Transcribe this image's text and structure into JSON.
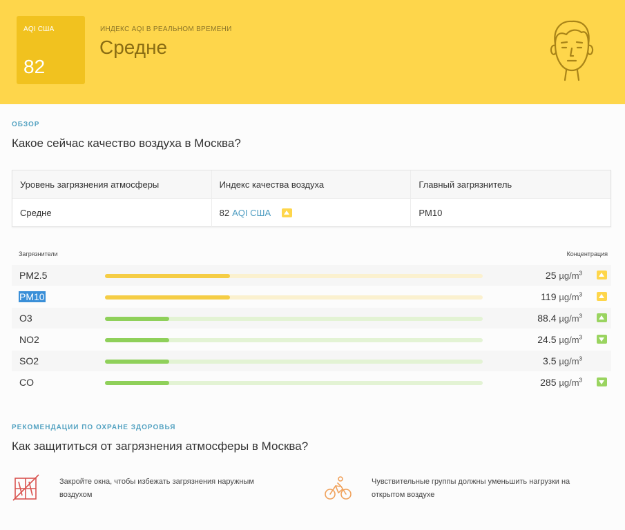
{
  "header": {
    "aqi_label": "AQI США",
    "aqi_value": "82",
    "live_label": "ИНДЕКС AQI В РЕАЛЬНОМ ВРЕМЕНИ",
    "status": "Средне"
  },
  "overview": {
    "section_label": "ОБЗОР",
    "title": "Какое сейчас качество воздуха в Москва?",
    "headers": [
      "Уровень загрязнения атмосферы",
      "Индекс качества воздуха",
      "Главный загрязнитель"
    ],
    "level": "Средне",
    "aqi_number": "82",
    "aqi_unit": "AQI США",
    "main_pollutant": "PM10"
  },
  "pollutants": {
    "col_name": "Загрязнители",
    "col_value": "Концентрация",
    "items": [
      {
        "name": "PM2.5",
        "value": "25",
        "unit": "µg/m",
        "sup": "3",
        "level": 0.33,
        "color": "#f5cd45",
        "track": "#fbf1cf",
        "trend": "up",
        "trend_color": "yellow"
      },
      {
        "name": "PM10",
        "value": "119",
        "unit": "µg/m",
        "sup": "3",
        "level": 0.33,
        "color": "#f5cd45",
        "track": "#fbf1cf",
        "trend": "up",
        "trend_color": "yellow"
      },
      {
        "name": "O3",
        "value": "88.4",
        "unit": "µg/m",
        "sup": "3",
        "level": 0.17,
        "color": "#8fd05a",
        "track": "#e3f3d4",
        "trend": "up",
        "trend_color": "green"
      },
      {
        "name": "NO2",
        "value": "24.5",
        "unit": "µg/m",
        "sup": "3",
        "level": 0.17,
        "color": "#8fd05a",
        "track": "#e3f3d4",
        "trend": "down",
        "trend_color": "green"
      },
      {
        "name": "SO2",
        "value": "3.5",
        "unit": "µg/m",
        "sup": "3",
        "level": 0.17,
        "color": "#8fd05a",
        "track": "#e3f3d4",
        "trend": "none",
        "trend_color": "green"
      },
      {
        "name": "CO",
        "value": "285",
        "unit": "µg/m",
        "sup": "3",
        "level": 0.17,
        "color": "#8fd05a",
        "track": "#e3f3d4",
        "trend": "down",
        "trend_color": "green"
      }
    ]
  },
  "health": {
    "section_label": "РЕКОМЕНДАЦИИ ПО ОХРАНЕ ЗДОРОВЬЯ",
    "title": "Как защититься от загрязнения атмосферы в Москва?",
    "rec1": "Закройте окна, чтобы избежать загрязнения наружным воздухом",
    "rec2": "Чувствительные группы должны уменьшить нагрузки на открытом воздухе",
    "rec1_icon": "closed-window-icon",
    "rec2_icon": "cyclist-icon"
  }
}
